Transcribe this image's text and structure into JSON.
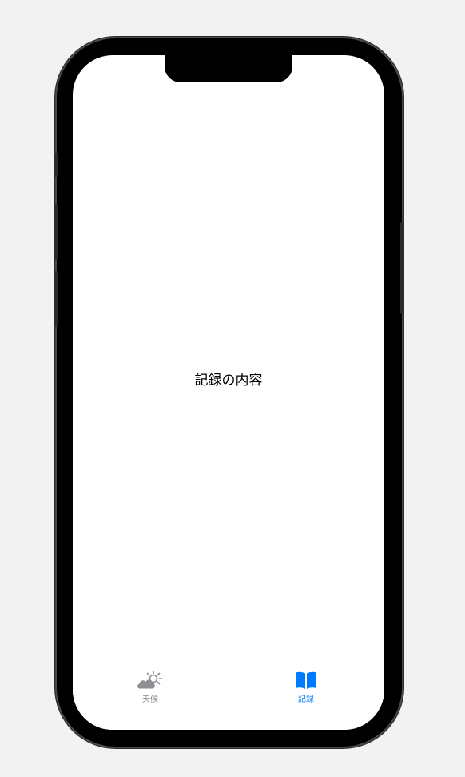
{
  "main": {
    "content_text": "記録の内容"
  },
  "tabbar": {
    "tabs": [
      {
        "label": "天候",
        "icon": "cloud-sun-icon",
        "selected": false
      },
      {
        "label": "記録",
        "icon": "book-icon",
        "selected": true
      }
    ]
  },
  "colors": {
    "accent": "#007aff",
    "inactive": "#8e8e93",
    "background": "#f2f2f2",
    "screen": "#ffffff"
  }
}
